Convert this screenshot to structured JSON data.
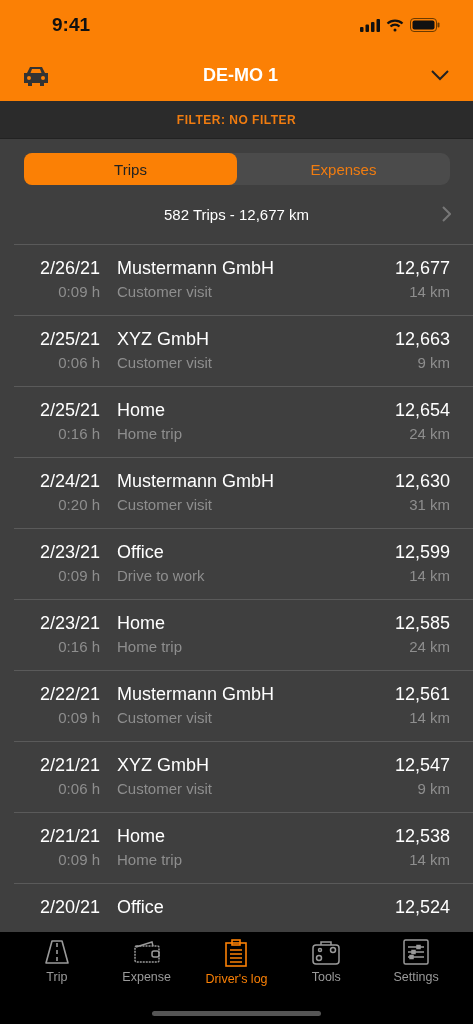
{
  "status_bar": {
    "time": "9:41"
  },
  "header": {
    "title": "DE-MO 1"
  },
  "filter": {
    "label": "FILTER: NO FILTER"
  },
  "segments": [
    {
      "label": "Trips",
      "selected": true
    },
    {
      "label": "Expenses",
      "selected": false
    }
  ],
  "summary": {
    "text": "582 Trips - 12,677 km"
  },
  "trips": [
    {
      "date": "2/26/21",
      "duration": "0:09 h",
      "title": "Mustermann GmbH",
      "purpose": "Customer visit",
      "odometer": "12,677",
      "distance": "14 km"
    },
    {
      "date": "2/25/21",
      "duration": "0:06 h",
      "title": "XYZ GmbH",
      "purpose": "Customer visit",
      "odometer": "12,663",
      "distance": "9 km"
    },
    {
      "date": "2/25/21",
      "duration": "0:16 h",
      "title": "Home",
      "purpose": "Home trip",
      "odometer": "12,654",
      "distance": "24 km"
    },
    {
      "date": "2/24/21",
      "duration": "0:20 h",
      "title": "Mustermann GmbH",
      "purpose": "Customer visit",
      "odometer": "12,630",
      "distance": "31 km"
    },
    {
      "date": "2/23/21",
      "duration": "0:09 h",
      "title": "Office",
      "purpose": "Drive to work",
      "odometer": "12,599",
      "distance": "14 km"
    },
    {
      "date": "2/23/21",
      "duration": "0:16 h",
      "title": "Home",
      "purpose": "Home trip",
      "odometer": "12,585",
      "distance": "24 km"
    },
    {
      "date": "2/22/21",
      "duration": "0:09 h",
      "title": "Mustermann GmbH",
      "purpose": "Customer visit",
      "odometer": "12,561",
      "distance": "14 km"
    },
    {
      "date": "2/21/21",
      "duration": "0:06 h",
      "title": "XYZ GmbH",
      "purpose": "Customer visit",
      "odometer": "12,547",
      "distance": "9 km"
    },
    {
      "date": "2/21/21",
      "duration": "0:09 h",
      "title": "Home",
      "purpose": "Home trip",
      "odometer": "12,538",
      "distance": "14 km"
    },
    {
      "date": "2/20/21",
      "title": "Office",
      "odometer": "12,524"
    }
  ],
  "tab_bar": [
    {
      "label": "Trip",
      "selected": false
    },
    {
      "label": "Expense",
      "selected": false
    },
    {
      "label": "Driver's log",
      "selected": true
    },
    {
      "label": "Tools",
      "selected": false
    },
    {
      "label": "Settings",
      "selected": false
    }
  ]
}
